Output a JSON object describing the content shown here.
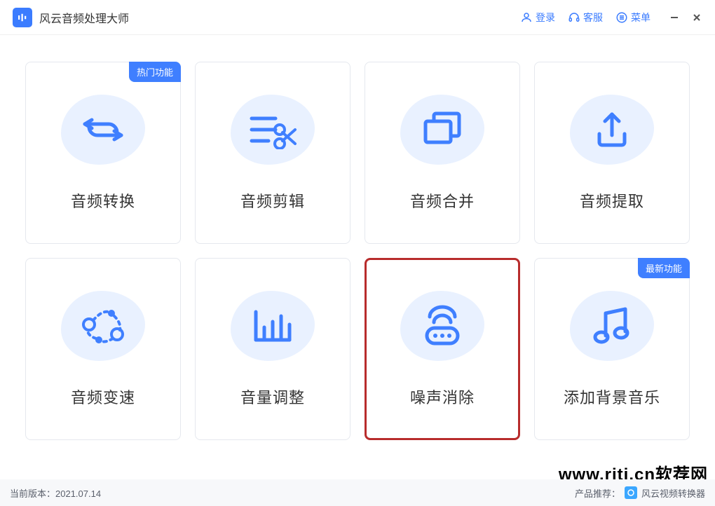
{
  "app": {
    "title": "风云音频处理大师"
  },
  "header": {
    "login": "登录",
    "support": "客服",
    "menu": "菜单"
  },
  "badges": {
    "hot": "热门功能",
    "new": "最新功能"
  },
  "cards": {
    "convert": "音频转换",
    "cut": "音频剪辑",
    "merge": "音频合并",
    "extract": "音频提取",
    "speed": "音频变速",
    "volume": "音量调整",
    "noise": "噪声消除",
    "bgm": "添加背景音乐"
  },
  "footer": {
    "version_label": "当前版本：",
    "version_value": "2021.07.14",
    "recommend_label": "产品推荐：",
    "recommend_product": "风云视频转换器"
  },
  "watermark": "www.rjtj.cn软荐网"
}
